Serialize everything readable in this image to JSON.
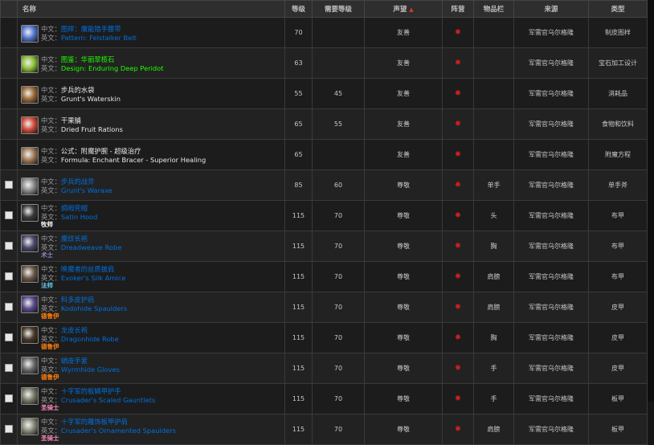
{
  "headers": {
    "name": "名称",
    "level": "等级",
    "req_level": "需要等级",
    "reputation": "声望",
    "faction": "阵营",
    "slot": "物品栏",
    "source": "来源",
    "type": "类型"
  },
  "sort_icon": "sort-desc-icon",
  "faction_icon": "horde-icon",
  "rows": [
    {
      "cn_label": "中文：",
      "cn": "图样：魔能猎手腰带",
      "en_label": "英文：",
      "en": "Pattern: Felstalker Belt",
      "quality": "pr",
      "note": "",
      "note_color": "",
      "level": "70",
      "req": "",
      "rep": "友善",
      "slot": "",
      "source": "军需官乌尔格隆",
      "type": "制皮图样",
      "checkbox": false,
      "icon_color": "#5577cc"
    },
    {
      "cn_label": "中文：",
      "cn": "图鉴：华丽翠榄石",
      "en_label": "英文：",
      "en": "Design: Enduring Deep Peridot",
      "quality": "gr",
      "note": "",
      "note_color": "",
      "level": "63",
      "req": "",
      "rep": "友善",
      "slot": "",
      "source": "军需官乌尔格隆",
      "type": "宝石加工设计",
      "checkbox": false,
      "icon_color": "#8cbf3a"
    },
    {
      "cn_label": "中文：",
      "cn": "步兵的水袋",
      "en_label": "英文：",
      "en": "Grunt's Waterskin",
      "quality": "wh",
      "note": "",
      "note_color": "",
      "level": "55",
      "req": "45",
      "rep": "友善",
      "slot": "",
      "source": "军需官乌尔格隆",
      "type": "消耗品",
      "checkbox": false,
      "icon_color": "#9b6a3a"
    },
    {
      "cn_label": "中文：",
      "cn": "干果脯",
      "en_label": "英文：",
      "en": "Dried Fruit Rations",
      "quality": "wh",
      "note": "",
      "note_color": "",
      "level": "65",
      "req": "55",
      "rep": "友善",
      "slot": "",
      "source": "军需官乌尔格隆",
      "type": "食物和饮料",
      "checkbox": false,
      "icon_color": "#d04a3a"
    },
    {
      "cn_label": "中文：",
      "cn": "公式：附魔护腕 - 超级治疗",
      "en_label": "英文：",
      "en": "Formula: Enchant Bracer - Superior Healing",
      "quality": "wh",
      "note": "",
      "note_color": "",
      "level": "65",
      "req": "",
      "rep": "友善",
      "slot": "",
      "source": "军需官乌尔格隆",
      "type": "附魔方程",
      "checkbox": false,
      "icon_color": "#a07a5a"
    },
    {
      "cn_label": "中文：",
      "cn": "步兵的战斧",
      "en_label": "英文：",
      "en": "Grunt's Waraxe",
      "quality": "pr",
      "note": "",
      "note_color": "",
      "level": "85",
      "req": "60",
      "rep": "尊敬",
      "slot": "单手",
      "source": "军需官乌尔格隆",
      "type": "单手斧",
      "checkbox": true,
      "icon_color": "#8a8a8a"
    },
    {
      "cn_label": "中文：",
      "cn": "绸缎兜帽",
      "en_label": "英文：",
      "en": "Satin Hood",
      "quality": "pr",
      "note": "牧师",
      "note_color": "#ffffff",
      "level": "115",
      "req": "70",
      "rep": "尊敬",
      "slot": "头",
      "source": "军需官乌尔格隆",
      "type": "布甲",
      "checkbox": true,
      "icon_color": "#3a3a3a"
    },
    {
      "cn_label": "中文：",
      "cn": "魔纹长袍",
      "en_label": "英文：",
      "en": "Dreadweave Robe",
      "quality": "pr",
      "note": "术士",
      "note_color": "#9482c9",
      "level": "115",
      "req": "70",
      "rep": "尊敬",
      "slot": "胸",
      "source": "军需官乌尔格隆",
      "type": "布甲",
      "checkbox": true,
      "icon_color": "#4a4a6a"
    },
    {
      "cn_label": "中文：",
      "cn": "唤魔者的丝质披肩",
      "en_label": "英文：",
      "en": "Evoker's Silk Amice",
      "quality": "pr",
      "note": "法师",
      "note_color": "#69ccf0",
      "level": "115",
      "req": "70",
      "rep": "尊敬",
      "slot": "肩膀",
      "source": "军需官乌尔格隆",
      "type": "布甲",
      "checkbox": true,
      "icon_color": "#6a5a4a"
    },
    {
      "cn_label": "中文：",
      "cn": "科多皮护肩",
      "en_label": "英文：",
      "en": "Kodohide Spaulders",
      "quality": "pr",
      "note": "德鲁伊",
      "note_color": "#ff7d0a",
      "level": "115",
      "req": "70",
      "rep": "尊敬",
      "slot": "肩膀",
      "source": "军需官乌尔格隆",
      "type": "皮甲",
      "checkbox": true,
      "icon_color": "#5a4a8a"
    },
    {
      "cn_label": "中文：",
      "cn": "龙皮长袍",
      "en_label": "英文：",
      "en": "Dragonhide Robe",
      "quality": "pr",
      "note": "德鲁伊",
      "note_color": "#ff7d0a",
      "level": "115",
      "req": "70",
      "rep": "尊敬",
      "slot": "胸",
      "source": "军需官乌尔格隆",
      "type": "皮甲",
      "checkbox": true,
      "icon_color": "#4a3a2a"
    },
    {
      "cn_label": "中文：",
      "cn": "蛸皮手套",
      "en_label": "英文：",
      "en": "Wyrmhide Gloves",
      "quality": "pr",
      "note": "德鲁伊",
      "note_color": "#ff7d0a",
      "level": "115",
      "req": "70",
      "rep": "尊敬",
      "slot": "手",
      "source": "军需官乌尔格隆",
      "type": "皮甲",
      "checkbox": true,
      "icon_color": "#6a6a6a"
    },
    {
      "cn_label": "中文：",
      "cn": "十字军的板鳞甲护手",
      "en_label": "英文：",
      "en": "Crusader's Scaled Gauntlets",
      "quality": "pr",
      "note": "圣骑士",
      "note_color": "#f58cba",
      "level": "115",
      "req": "70",
      "rep": "尊敬",
      "slot": "手",
      "source": "军需官乌尔格隆",
      "type": "板甲",
      "checkbox": true,
      "icon_color": "#7a7a6a"
    },
    {
      "cn_label": "中文：",
      "cn": "十字军的雕饰板甲护肩",
      "en_label": "英文：",
      "en": "Crusader's Ornamented Spaulders",
      "quality": "pr",
      "note": "圣骑士",
      "note_color": "#f58cba",
      "level": "115",
      "req": "70",
      "rep": "尊敬",
      "slot": "肩膀",
      "source": "军需官乌尔格隆",
      "type": "板甲",
      "checkbox": true,
      "icon_color": "#8a8a7a"
    }
  ]
}
